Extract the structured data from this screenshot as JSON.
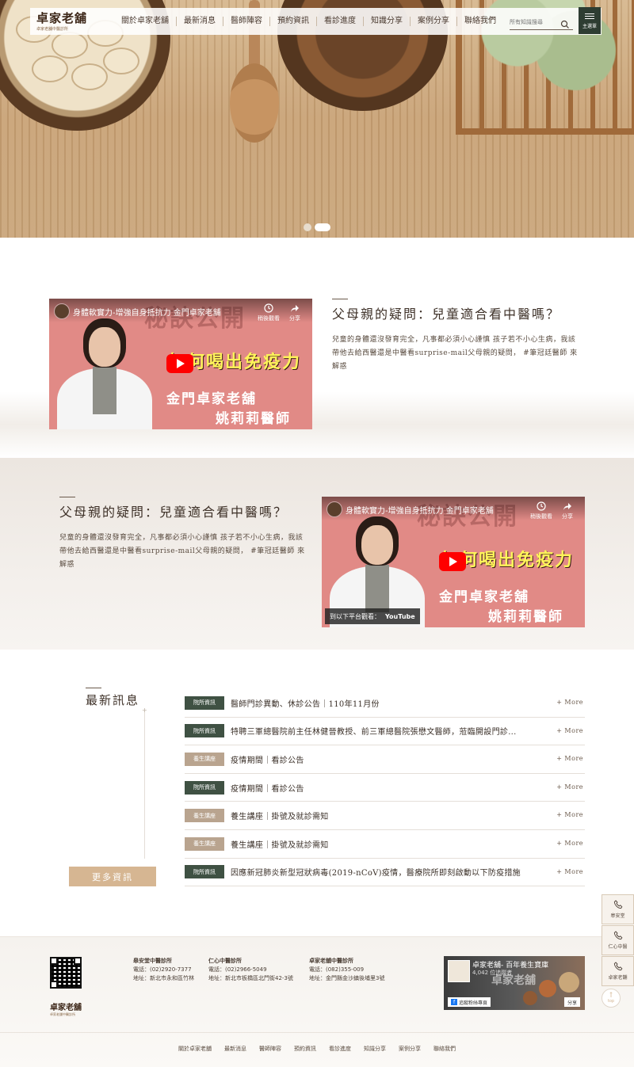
{
  "header": {
    "logo_text": "卓家老舖",
    "logo_sub": "卓家老舖中醫診所",
    "nav": [
      "關於卓家老舖",
      "最新消息",
      "醫師陣容",
      "預約資訊",
      "看診進度",
      "知識分享",
      "案例分享",
      "聯絡我們"
    ],
    "search_placeholder": "所有知識搜尋",
    "main_menu_label": "主選單"
  },
  "hero": {
    "slide_count": 2,
    "active_slide": 2
  },
  "video_block_1": {
    "heading": "父母親的疑問：兒童適合看中醫嗎？",
    "body": "兒童的身體還沒發育完全，凡事都必須小心謹慎 孩子若不小心生病，我該帶他去給西醫還是中醫看surprise-mail父母親的疑問， #筆冠廷醫師 來解惑",
    "video": {
      "title": "身體軟實力-增強自身抵抗力 金門卓家老舖",
      "watch_label": "稍後觀看",
      "share_label": "分享",
      "watermark": "秘訣公開",
      "headline": "如何喝出免疫力",
      "shop": "金門卓家老舖",
      "doctor": "姚莉莉醫師"
    }
  },
  "video_block_2": {
    "heading": "父母親的疑問：兒童適合看中醫嗎？",
    "body": "兒童的身體還沒發育完全，凡事都必須小心謹慎 孩子若不小心生病，我該帶他去給西醫還是中醫看surprise-mail父母親的疑問， #筆冠廷醫師 來解惑",
    "video": {
      "title": "身體軟實力-增強自身抵抗力 金門卓家老舖",
      "watch_label": "稍後觀看",
      "share_label": "分享",
      "watermark": "秘訣公開",
      "headline": "如何喝出免疫力",
      "shop": "金門卓家老舖",
      "doctor": "姚莉莉醫師",
      "yt_label": "到以下平台觀看：",
      "yt_brand": "YouTube"
    }
  },
  "news": {
    "title": "最新訊息",
    "more_button": "更多資訊",
    "more_label": "+ More",
    "items": [
      {
        "tag": "院所資訊",
        "tag_style": "green",
        "title": "醫師門診異動、休診公告｜110年11月份"
      },
      {
        "tag": "院所資訊",
        "tag_style": "green",
        "title": "特聘三軍總醫院前主任林健晉教授、前三軍總醫院張懋文醫師，蒞臨開設門診..."
      },
      {
        "tag": "養生講座",
        "tag_style": "tan",
        "title": "疫情期間｜看診公告"
      },
      {
        "tag": "院所資訊",
        "tag_style": "green",
        "title": "疫情期間｜看診公告"
      },
      {
        "tag": "養生講座",
        "tag_style": "tan",
        "title": "養生講座｜掛號及就診需知"
      },
      {
        "tag": "養生講座",
        "tag_style": "tan",
        "title": "養生講座｜掛號及就診需知"
      },
      {
        "tag": "院所資訊",
        "tag_style": "green",
        "title": "因應新冠肺炎新型冠狀病毒(2019-nCoV)疫情，醫療院所即刻啟動以下防疫措施"
      }
    ]
  },
  "footer": {
    "logo_text": "卓家老舖",
    "logo_sub": "卓家老舖中醫診所",
    "clinics": [
      {
        "name": "皋安堂中醫診所",
        "phone": "電話：(02)2920-7377",
        "address": "地址：新北市永和區竹林"
      },
      {
        "name": "仁心中醫診所",
        "phone": "電話：(02)2966-5049",
        "address": "地址：新北市板橋區北門街42-3號"
      },
      {
        "name": "卓家老舖中醫診所",
        "phone": "電話：(082)355-009",
        "address": "地址：金門縣金沙鎮後埔里3號"
      }
    ],
    "fb": {
      "name": "卓家老舖- 百年養生寶庫",
      "fans": "4,042 位追蹤者",
      "follow": "追蹤粉絲專頁",
      "share": "分享",
      "watermark": "卓家老舖"
    },
    "menu": [
      "關於卓家老舖",
      "最新消息",
      "醫師陣容",
      "預約資訊",
      "看診進度",
      "知識分享",
      "案例分享",
      "聯絡我們"
    ]
  },
  "float": {
    "buttons": [
      "皋安堂",
      "仁心中醫",
      "卓家老舖"
    ],
    "top_label": "top"
  }
}
